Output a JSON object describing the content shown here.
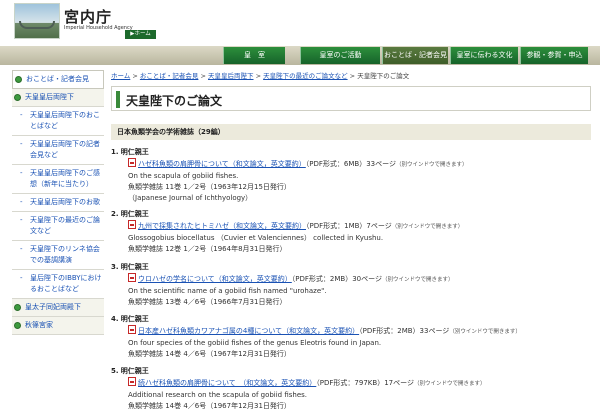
{
  "header": {
    "site_title": "宮内庁",
    "site_sub": "Imperial Household Agency",
    "home": "ホーム"
  },
  "gnav": [
    "皇　室",
    "皇室のご活動",
    "おことば・記者会見",
    "皇室に伝わる文化",
    "参観・参賀・申込"
  ],
  "sidebar": {
    "top": "おことば・記者会見",
    "items": [
      {
        "label": "天皇皇后両陛下",
        "type": "cat"
      },
      {
        "label": "天皇皇后両陛下のおことばなど",
        "type": "sub"
      },
      {
        "label": "天皇皇后両陛下の記者会見など",
        "type": "sub"
      },
      {
        "label": "天皇皇后両陛下のご感想（新年に当たり）",
        "type": "sub"
      },
      {
        "label": "天皇皇后両陛下のお歌",
        "type": "sub"
      },
      {
        "label": "天皇陛下の最近のご論文など",
        "type": "sub"
      },
      {
        "label": "天皇陛下のリンネ協会での基調講演",
        "type": "sub"
      },
      {
        "label": "皇后陛下のIBBYにおけるおことばなど",
        "type": "sub"
      },
      {
        "label": "皇太子同妃両殿下",
        "type": "cat"
      },
      {
        "label": "秋篠宮家",
        "type": "cat"
      }
    ]
  },
  "breadcrumb": {
    "links": [
      "ホーム",
      "おことば・記者会見",
      "天皇皇后両陛下",
      "天皇陛下の最近のご論文など"
    ],
    "sep": " > ",
    "current": "天皇陛下のご論文"
  },
  "page_title": "天皇陛下のご論文",
  "section_title": "日本魚類学会の学術雑誌（29編）",
  "entries": [
    {
      "num": "1.",
      "author": "明仁親王",
      "link": "ハゼ科魚類の肩胛骨について（和文論文，英文要約）",
      "meta": "（PDF形式：6MB）33ページ",
      "note": "（別ウインドウで開きます）",
      "english": "On the scapula of gobiid fishes.",
      "journal": "魚類学雑誌 11巻 1／2号（1963年12月15日発行）",
      "extra": "（Japanese Journal of Ichthyology）"
    },
    {
      "num": "2.",
      "author": "明仁親王",
      "link": "九州で採集されたヒトミハゼ（和文論文，英文要約）",
      "meta": "（PDF形式：1MB）7ページ",
      "note": "（別ウインドウで開きます）",
      "english": "Glossogobius biocellatus （Cuvier et Valenciennes） collected in Kyushu.",
      "journal": "魚類学雑誌 12巻 1／2号（1964年8月31日発行）"
    },
    {
      "num": "3.",
      "author": "明仁親王",
      "link": "ウロハゼの学名について（和文論文，英文要約）",
      "meta": "（PDF形式：2MB）30ページ",
      "note": "（別ウインドウで開きます）",
      "english": "On the scientific name of a gobiid fish named \"urohaze\".",
      "journal": "魚類学雑誌 13巻 4／6号（1966年7月31日発行）"
    },
    {
      "num": "4.",
      "author": "明仁親王",
      "link": "日本産ハゼ科魚類カワアナゴ属の4種について（和文論文，英文要約）",
      "meta": "（PDF形式：2MB）33ページ",
      "note": "（別ウインドウで開きます）",
      "english": "On four species of the gobiid fishes of the genus Eleotris found in Japan.",
      "journal": "魚類学雑誌 14巻 4／6号（1967年12月31日発行）"
    },
    {
      "num": "5.",
      "author": "明仁親王",
      "link": "続ハゼ科魚類の肩胛骨について　（和文論文，英文要約）",
      "meta": "（PDF形式：797KB）17ページ",
      "note": "（別ウインドウで開きます）",
      "english": "Additional research on the scapula of gobiid fishes.",
      "journal": "魚類学雑誌 14巻 4／6号（1967年12月31日発行）"
    }
  ]
}
